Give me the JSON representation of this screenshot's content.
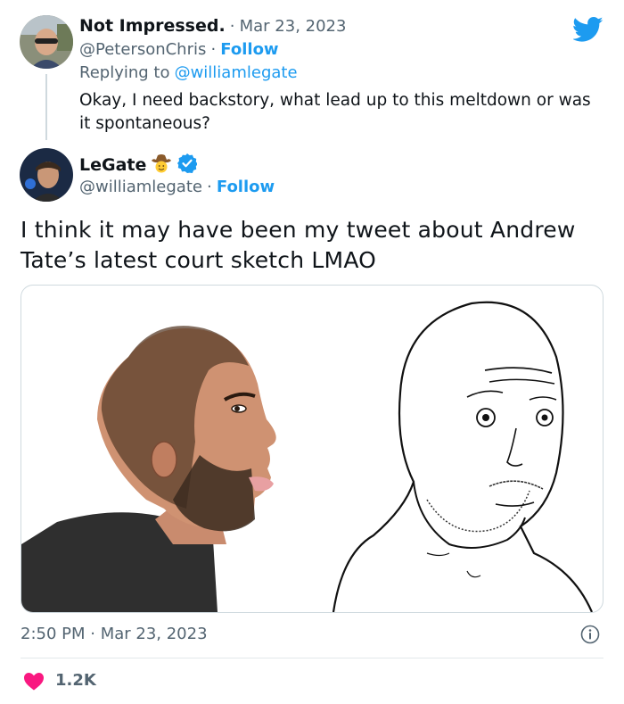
{
  "reply": {
    "display_name": "Not Impressed.",
    "separator": "·",
    "date": "Mar 23, 2023",
    "handle": "@PetersonChris",
    "dot": "·",
    "follow": "Follow",
    "replying_prefix": "Replying to",
    "replying_to": "@williamlegate",
    "text": "Okay, I need backstory, what lead up to this meltdown or was it spontaneous?"
  },
  "tweet": {
    "display_name": "LeGate",
    "handle": "@williamlegate",
    "dot": "·",
    "follow": "Follow",
    "text": "I think it may have been my tweet about Andrew Tate’s latest court sketch LMAO",
    "timestamp": "2:50 PM · Mar 23, 2023",
    "likes": "1.2K"
  },
  "colors": {
    "twitter_blue": "#1d9bf0",
    "like_red": "#f91880",
    "secondary_text": "#536471"
  },
  "icons": [
    "twitter-bird-icon",
    "verified-badge-icon",
    "cowboy-emoji-icon",
    "info-icon",
    "heart-icon"
  ]
}
